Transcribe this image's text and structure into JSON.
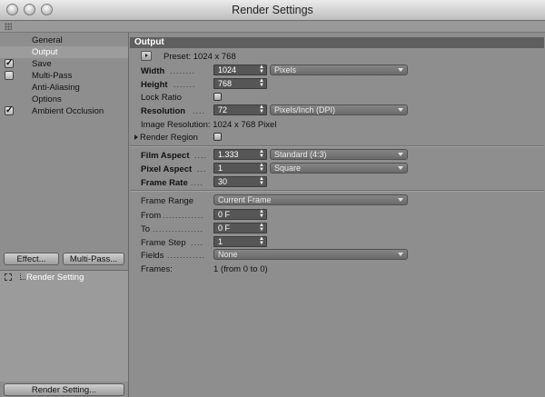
{
  "window": {
    "title": "Render Settings"
  },
  "sidebar": {
    "items": [
      {
        "label": "General",
        "checkbox": false,
        "checked": false,
        "selected": false
      },
      {
        "label": "Output",
        "checkbox": false,
        "checked": false,
        "selected": true
      },
      {
        "label": "Save",
        "checkbox": true,
        "checked": true,
        "selected": false
      },
      {
        "label": "Multi-Pass",
        "checkbox": true,
        "checked": false,
        "selected": false
      },
      {
        "label": "Anti-Aliasing",
        "checkbox": false,
        "checked": false,
        "selected": false
      },
      {
        "label": "Options",
        "checkbox": false,
        "checked": false,
        "selected": false
      },
      {
        "label": "Ambient Occlusion",
        "checkbox": true,
        "checked": true,
        "selected": false
      }
    ],
    "effect_button": "Effect...",
    "multipass_button": "Multi-Pass...",
    "tree_item": "Render Setting",
    "render_setting_button": "Render Setting..."
  },
  "output": {
    "header": "Output",
    "preset": "Preset: 1024 x 768",
    "width": {
      "label": "Width",
      "value": "1024",
      "unit": "Pixels"
    },
    "height": {
      "label": "Height",
      "value": "768"
    },
    "lock_ratio": {
      "label": "Lock Ratio",
      "checked": false
    },
    "resolution": {
      "label": "Resolution",
      "value": "72",
      "unit": "Pixels/Inch (DPI)"
    },
    "image_resolution": "Image Resolution: 1024 x 768 Pixel",
    "render_region": {
      "label": "Render Region",
      "checked": false
    },
    "film_aspect": {
      "label": "Film Aspect",
      "value": "1.333",
      "preset": "Standard (4:3)"
    },
    "pixel_aspect": {
      "label": "Pixel Aspect",
      "value": "1",
      "preset": "Square"
    },
    "frame_rate": {
      "label": "Frame Rate",
      "value": "30"
    },
    "frame_range": {
      "label": "Frame Range",
      "value": "Current Frame"
    },
    "from": {
      "label": "From",
      "value": "0 F"
    },
    "to": {
      "label": "To",
      "value": "0 F"
    },
    "frame_step": {
      "label": "Frame Step",
      "value": "1"
    },
    "fields": {
      "label": "Fields",
      "value": "None"
    },
    "frames": {
      "label": "Frames:",
      "value": "1 (from 0 to 0)"
    }
  },
  "colors": {
    "panel_bg": "#8e8e8e",
    "section_header_bg": "#5f5f5f",
    "field_bg": "#565656",
    "selected_item_bg": "#9c9c9c"
  }
}
